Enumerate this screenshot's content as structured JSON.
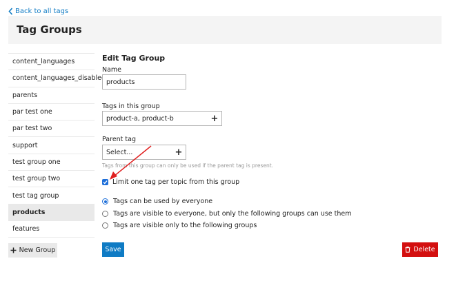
{
  "back_link": {
    "label": "Back to all tags",
    "icon": "chevron-left-icon"
  },
  "header": {
    "title": "Tag Groups"
  },
  "sidebar": {
    "items": [
      {
        "label": "content_languages",
        "active": false
      },
      {
        "label": "content_languages_disabled",
        "active": false
      },
      {
        "label": "parents",
        "active": false
      },
      {
        "label": "par test one",
        "active": false
      },
      {
        "label": "par test two",
        "active": false
      },
      {
        "label": "support",
        "active": false
      },
      {
        "label": "test group one",
        "active": false
      },
      {
        "label": "test group two",
        "active": false
      },
      {
        "label": "test tag group",
        "active": false
      },
      {
        "label": "products",
        "active": true
      },
      {
        "label": "features",
        "active": false
      }
    ],
    "new_group_label": "New Group"
  },
  "form": {
    "title": "Edit Tag Group",
    "name_label": "Name",
    "name_value": "products",
    "tags_label": "Tags in this group",
    "tags_value": "product-a, product-b",
    "parent_label": "Parent tag",
    "parent_value": "Select...",
    "parent_help": "Tags from this group can only be used if the parent tag is present.",
    "one_per_topic_label": "Limit one tag per topic from this group",
    "one_per_topic_checked": true,
    "visibility_options": [
      {
        "label": "Tags can be used by everyone",
        "checked": true
      },
      {
        "label": "Tags are visible to everyone, but only the following groups can use them",
        "checked": false
      },
      {
        "label": "Tags are visible only to the following groups",
        "checked": false
      }
    ],
    "save_label": "Save",
    "delete_label": "Delete"
  },
  "colors": {
    "accent": "#0f7bc4",
    "danger": "#d30f0f",
    "annotation_arrow": "#e02020"
  }
}
